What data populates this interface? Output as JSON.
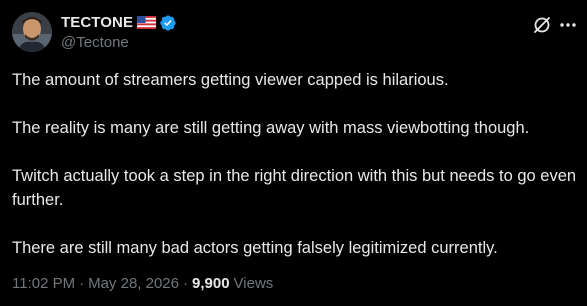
{
  "author": {
    "display_name": "TECTONE",
    "handle": "@Tectone"
  },
  "icons": {
    "flag": "us-flag-icon",
    "verified": "verified-badge-icon",
    "grok": "grok-icon",
    "more": "more-options-icon"
  },
  "tweet": {
    "paragraphs": [
      "The amount of streamers getting viewer capped is hilarious.",
      "The reality is many are still getting away with mass viewbotting though.",
      "Twitch actually took a step in the right direction with this but needs to go even further.",
      "There are still many bad actors getting falsely legitimized currently."
    ],
    "time": "11:02 PM",
    "date": "May 28, 2026",
    "separator": "·",
    "views_count": "9,900",
    "views_label": "Views"
  },
  "colors": {
    "background": "#000000",
    "text_primary": "#e7e9ea",
    "text_secondary": "#71767b",
    "verified_blue": "#1d9bf0"
  }
}
